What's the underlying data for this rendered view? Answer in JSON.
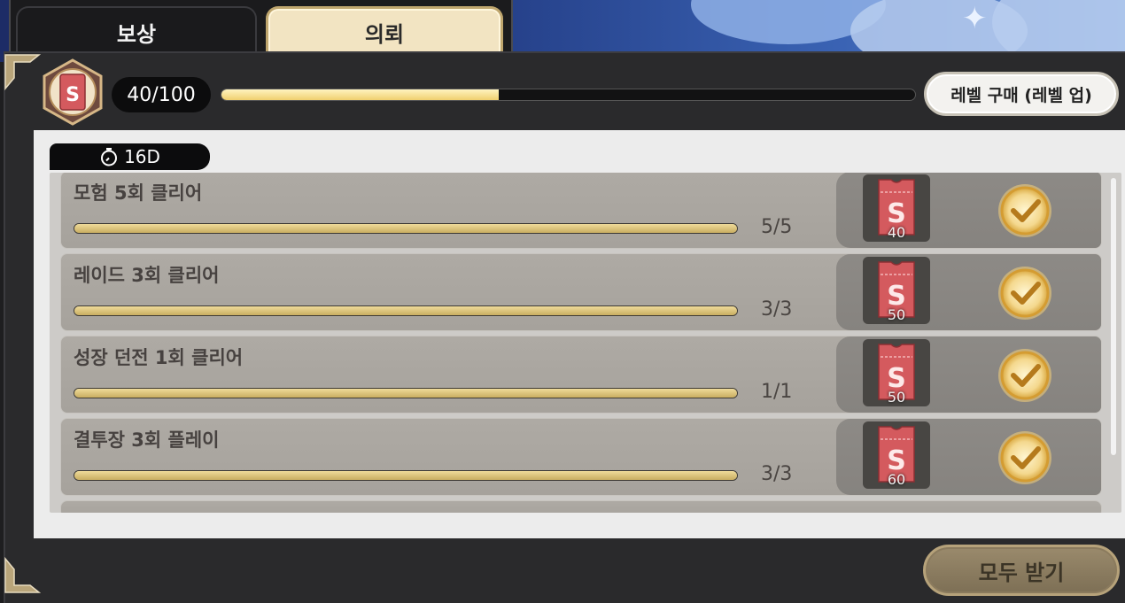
{
  "tabs": [
    {
      "label": "보상",
      "active": false
    },
    {
      "label": "의뢰",
      "active": true
    }
  ],
  "level": {
    "progress_text": "40/100",
    "progress_fraction": 0.4,
    "icon": "s-ticket-badge-icon"
  },
  "buy_button": {
    "label": "레벨 구매 (레벨 업)"
  },
  "timer": {
    "label": "16D",
    "icon": "stopwatch-icon"
  },
  "quests": [
    {
      "title": "모험 5회 클리어",
      "count": "5/5",
      "progress": 1.0,
      "reward": "40",
      "completed": true
    },
    {
      "title": "레이드 3회 클리어",
      "count": "3/3",
      "progress": 1.0,
      "reward": "50",
      "completed": true
    },
    {
      "title": "성장 던전 1회 클리어",
      "count": "1/1",
      "progress": 1.0,
      "reward": "50",
      "completed": true
    },
    {
      "title": "결투장 3회 플레이",
      "count": "3/3",
      "progress": 1.0,
      "reward": "60",
      "completed": true
    }
  ],
  "claim_all": {
    "label": "모두 받기",
    "enabled": false
  },
  "colors": {
    "gold": "#f0cf6e",
    "ticket_red": "#d45a5e",
    "panel": "#2a2a2c"
  }
}
